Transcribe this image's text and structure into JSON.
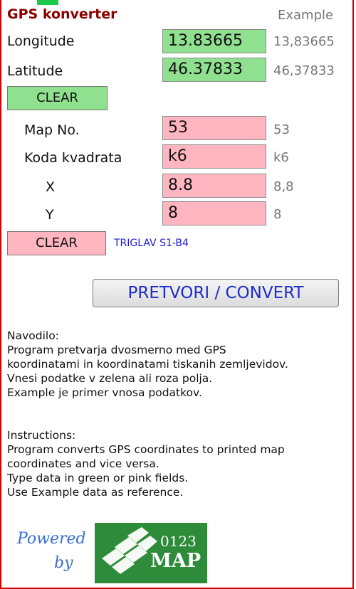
{
  "title": "GPS konverter",
  "example_header": "Example",
  "gps": {
    "longitude": {
      "label": "Longitude",
      "value": "13.83665",
      "example": "13,83665"
    },
    "latitude": {
      "label": "Latitude",
      "value": "46.37833",
      "example": "46,37833"
    },
    "clear_label": "CLEAR"
  },
  "map": {
    "map_no": {
      "label": "Map No.",
      "value": "53",
      "example": "53"
    },
    "koda": {
      "label": "Koda kvadrata",
      "value": "k6",
      "example": "k6"
    },
    "x": {
      "label": "X",
      "value": "8.8",
      "example": "8,8"
    },
    "y": {
      "label": "Y",
      "value": "8",
      "example": "8"
    },
    "clear_label": "CLEAR",
    "map_name": "TRIGLAV S1-B4"
  },
  "convert_label": "PRETVORI / CONVERT",
  "navodilo": {
    "heading": "Navodilo:",
    "lines": [
      "Program pretvarja dvosmerno med GPS",
      "koordinatami in koordinatami tiskanih zemljevidov.",
      "Vnesi podatke v zelena ali roza polja.",
      "Example je primer vnosa podatkov."
    ]
  },
  "instructions": {
    "heading": "Instructions:",
    "lines": [
      "Program converts GPS coordinates to printed map",
      "coordinates and vice versa.",
      "Type data in green or pink fields.",
      "Use Example data as reference."
    ]
  },
  "logo": {
    "powered": "Powered",
    "by": "by",
    "brand_number": "0123",
    "brand_name": "MAP"
  },
  "colors": {
    "green_field": "#8fe08f",
    "pink_field": "#ffb6c1",
    "title": "#8b0000",
    "accent_border": "#d80000"
  }
}
